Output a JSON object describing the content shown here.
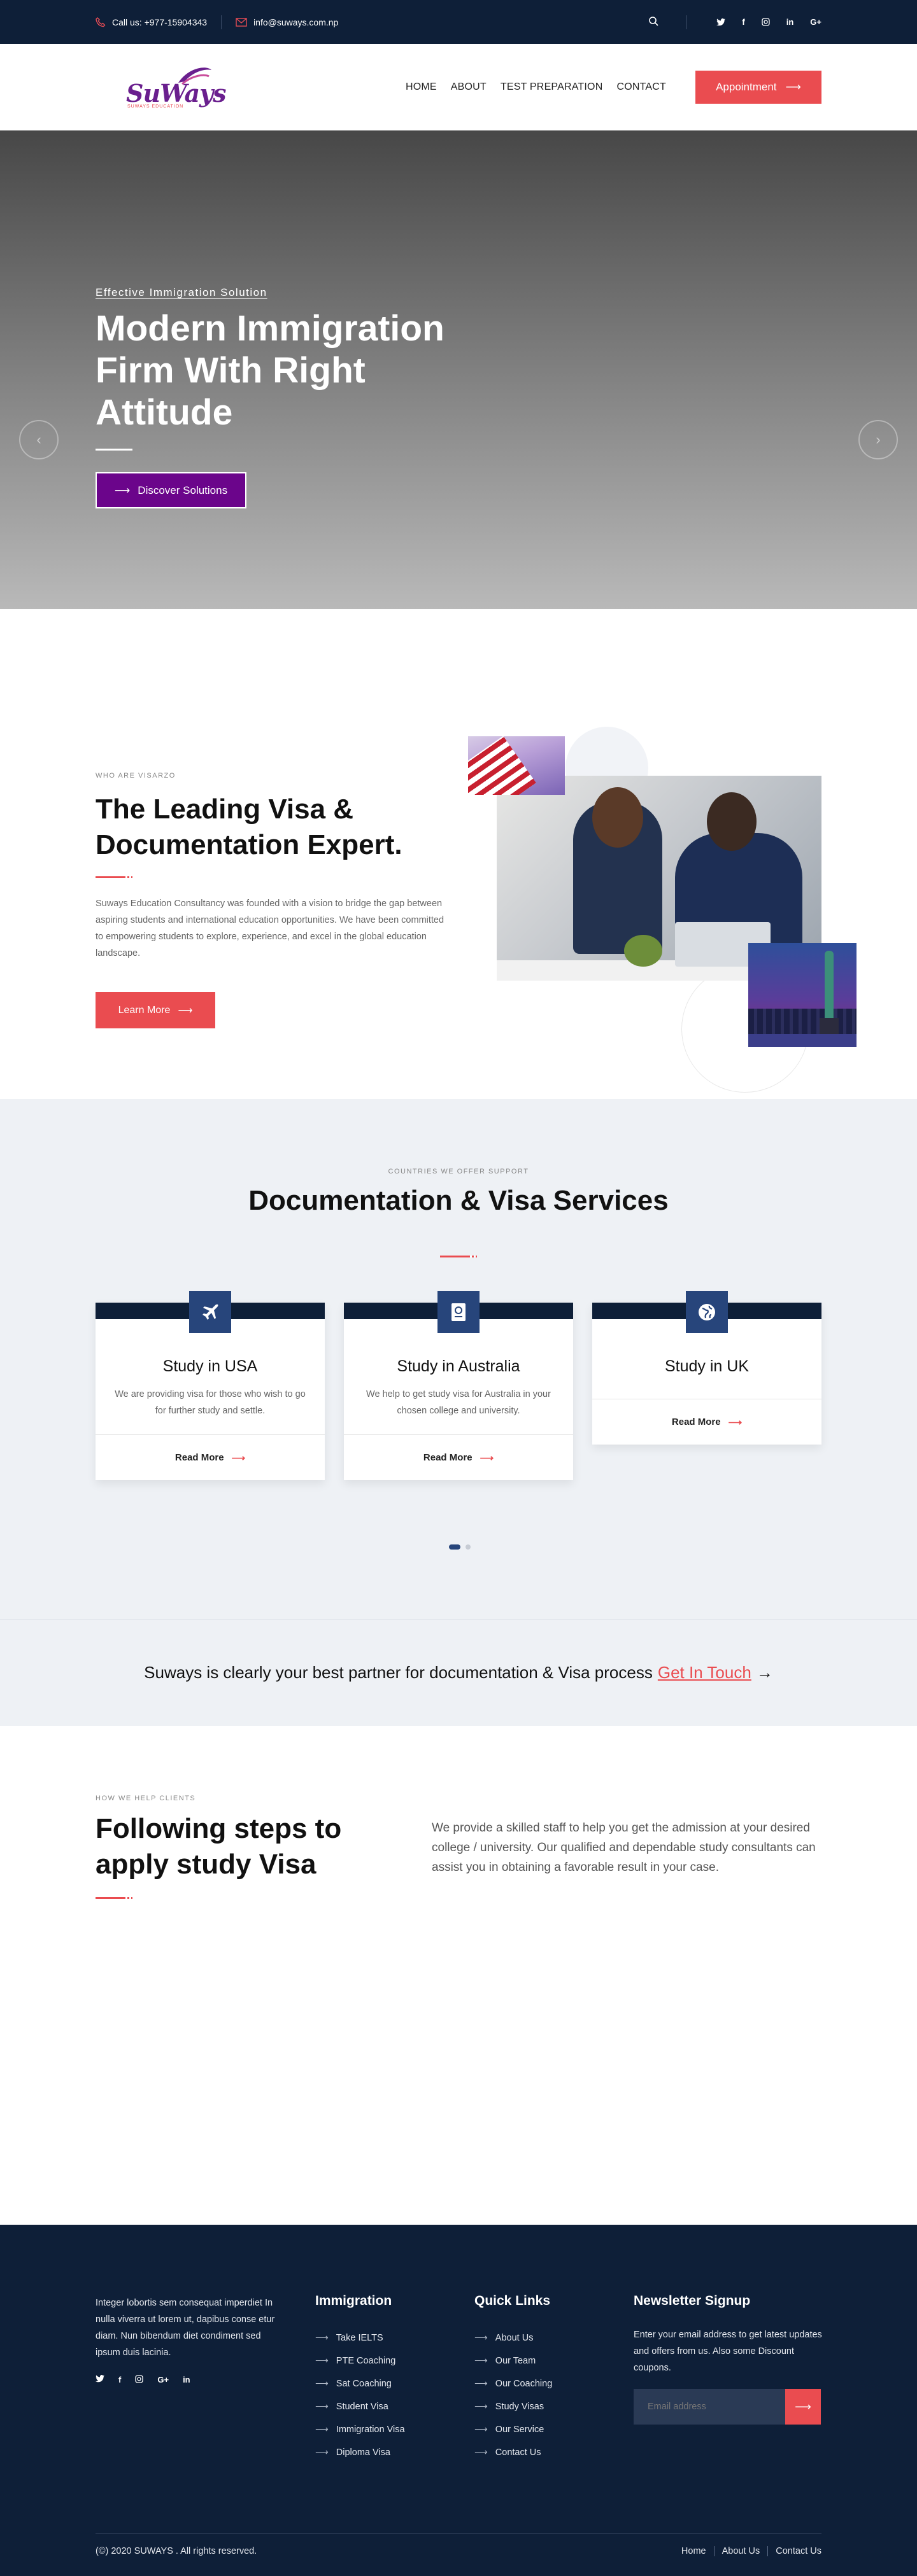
{
  "topbar": {
    "phone": "Call us: +977-15904343",
    "email": "info@suways.com.np",
    "social": [
      "twitter-icon",
      "facebook-icon",
      "instagram-icon",
      "linkedin-icon",
      "google-plus-icon"
    ]
  },
  "header": {
    "logo_text": "SuWays",
    "logo_sub": "SUWAYS EDUCATION",
    "nav": [
      "HOME",
      "ABOUT",
      "TEST PREPARATION",
      "CONTACT"
    ],
    "appointment": "Appointment"
  },
  "hero": {
    "subtitle": "Effective Immigration Solution",
    "title": "Modern Immigration Firm With Right Attitude",
    "button": "Discover Solutions"
  },
  "about": {
    "eyebrow": "WHO ARE VISARZO",
    "title": "The Leading Visa & Documentation Expert.",
    "text": "Suways Education Consultancy was founded with a vision to bridge the gap between aspiring students and international education opportunities. We have been committed to empowering students to explore, experience, and excel in the global education landscape.",
    "button": "Learn More"
  },
  "services": {
    "eyebrow": "COUNTRIES WE OFFER SUPPORT",
    "title": "Documentation & Visa Services",
    "cards": [
      {
        "title": "Study in USA",
        "text": "We are providing visa for those who wish to go for further study and settle.",
        "link": "Read More",
        "icon": "plane-icon"
      },
      {
        "title": "Study in Australia",
        "text": "We help to get study visa for Australia in your chosen college and university.",
        "link": "Read More",
        "icon": "passport-icon"
      },
      {
        "title": "Study in UK",
        "text": "",
        "link": "Read More",
        "icon": "globe-icon"
      }
    ]
  },
  "cta": {
    "text": "Suways is clearly your best partner for documentation & Visa process",
    "link": "Get In Touch",
    "arrow": "→"
  },
  "steps": {
    "eyebrow": "HOW WE HELP CLIENTS",
    "title": "Following steps to apply study Visa",
    "text": "We provide a skilled staff to help you get the admission at your desired college / university. Our qualified and dependable study consultants can assist you in obtaining a favorable result in your case."
  },
  "footer": {
    "about": "Integer lobortis sem consequat imperdiet In nulla viverra ut lorem ut, dapibus conse etur diam. Nun bibendum diet condiment sed ipsum duis lacinia.",
    "immigration_title": "Immigration",
    "immigration": [
      "Take IELTS",
      "PTE Coaching",
      "Sat Coaching",
      "Student Visa",
      "Immigration Visa",
      "Diploma Visa"
    ],
    "quick_title": "Quick Links",
    "quick": [
      "About Us",
      "Our Team",
      "Our Coaching",
      "Study Visas",
      "Our Service",
      "Contact Us"
    ],
    "news_title": "Newsletter Signup",
    "news_text": "Enter your email address to get latest updates and offers from us. Also some Discount coupons.",
    "email_placeholder": "Email address",
    "copyright": "(©) 2020 SUWAYS . All rights reserved.",
    "bottom_links": [
      "Home",
      "About Us",
      "Contact Us"
    ]
  },
  "colors": {
    "navy": "#0e1f38",
    "accent": "#ea4c50",
    "purple": "#6b058b",
    "icon_blue": "#27457b"
  }
}
